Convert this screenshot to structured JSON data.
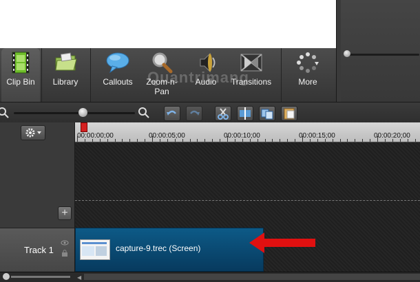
{
  "toolbar": {
    "tools": [
      {
        "label": "Clip Bin",
        "icon": "film-strip-icon",
        "active": true
      },
      {
        "label": "Library",
        "icon": "folder-icon"
      },
      {
        "label": "Callouts",
        "icon": "speech-bubble-icon"
      },
      {
        "label": "Zoom-n-\nPan",
        "icon": "magnifier-icon"
      },
      {
        "label": "Audio",
        "icon": "speaker-icon"
      },
      {
        "label": "Transitions",
        "icon": "transition-icon"
      },
      {
        "label": "More",
        "icon": "spinner-dots-icon"
      }
    ]
  },
  "ruler": {
    "ticks": [
      "00:00:00;00",
      "00:00:05;00",
      "00:00:10;00",
      "00:00:15;00",
      "00:00:20;00"
    ]
  },
  "tracks": {
    "track1_label": "Track 1",
    "clip_label": "capture-9.trec (Screen)"
  },
  "watermark": "Quantrimang",
  "colors": {
    "clip": "#0d5a87",
    "arrow": "#e01010",
    "toolbar": "#444444"
  }
}
